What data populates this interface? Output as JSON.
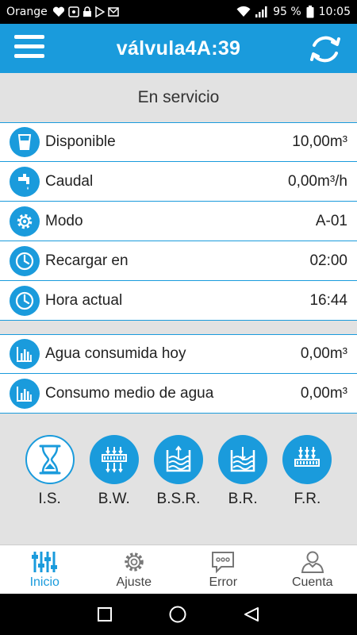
{
  "status_bar": {
    "carrier": "Orange",
    "battery": "95 %",
    "time": "10:05"
  },
  "app_bar": {
    "title": "válvula4A:39",
    "menu_icon": "hamburger-menu-icon",
    "refresh_icon": "refresh-icon"
  },
  "status_text": "En servicio",
  "info_rows": [
    {
      "label": "Disponible",
      "value": "10,00m³",
      "icon": "water-glass-icon"
    },
    {
      "label": "Caudal",
      "value": "0,00m³/h",
      "icon": "faucet-icon"
    },
    {
      "label": "Modo",
      "value": "A-01",
      "icon": "gear-icon"
    },
    {
      "label": "Recargar en",
      "value": "02:00",
      "icon": "clock-icon"
    },
    {
      "label": "Hora actual",
      "value": "16:44",
      "icon": "clock-icon"
    }
  ],
  "consumption_rows": [
    {
      "label": "Agua consumida hoy",
      "value": "0,00m³",
      "icon": "bar-chart-icon"
    },
    {
      "label": "Consumo medio de agua",
      "value": "0,00m³",
      "icon": "bar-chart-icon"
    }
  ],
  "modes": [
    {
      "label": "I.S.",
      "icon": "hourglass-icon",
      "active": true
    },
    {
      "label": "B.W.",
      "icon": "backwash-icon",
      "active": false
    },
    {
      "label": "B.S.R.",
      "icon": "brine-suction-icon",
      "active": false
    },
    {
      "label": "B.R.",
      "icon": "brine-refill-icon",
      "active": false
    },
    {
      "label": "F.R.",
      "icon": "fast-rinse-icon",
      "active": false
    }
  ],
  "bottom_nav": [
    {
      "label": "Inicio",
      "icon": "sliders-icon",
      "active": true
    },
    {
      "label": "Ajuste",
      "icon": "gear-icon",
      "active": false
    },
    {
      "label": "Error",
      "icon": "message-icon",
      "active": false
    },
    {
      "label": "Cuenta",
      "icon": "user-icon",
      "active": false
    }
  ],
  "colors": {
    "accent": "#1a9bdc",
    "background": "#e2e2e2",
    "status_bar": "#000000"
  }
}
